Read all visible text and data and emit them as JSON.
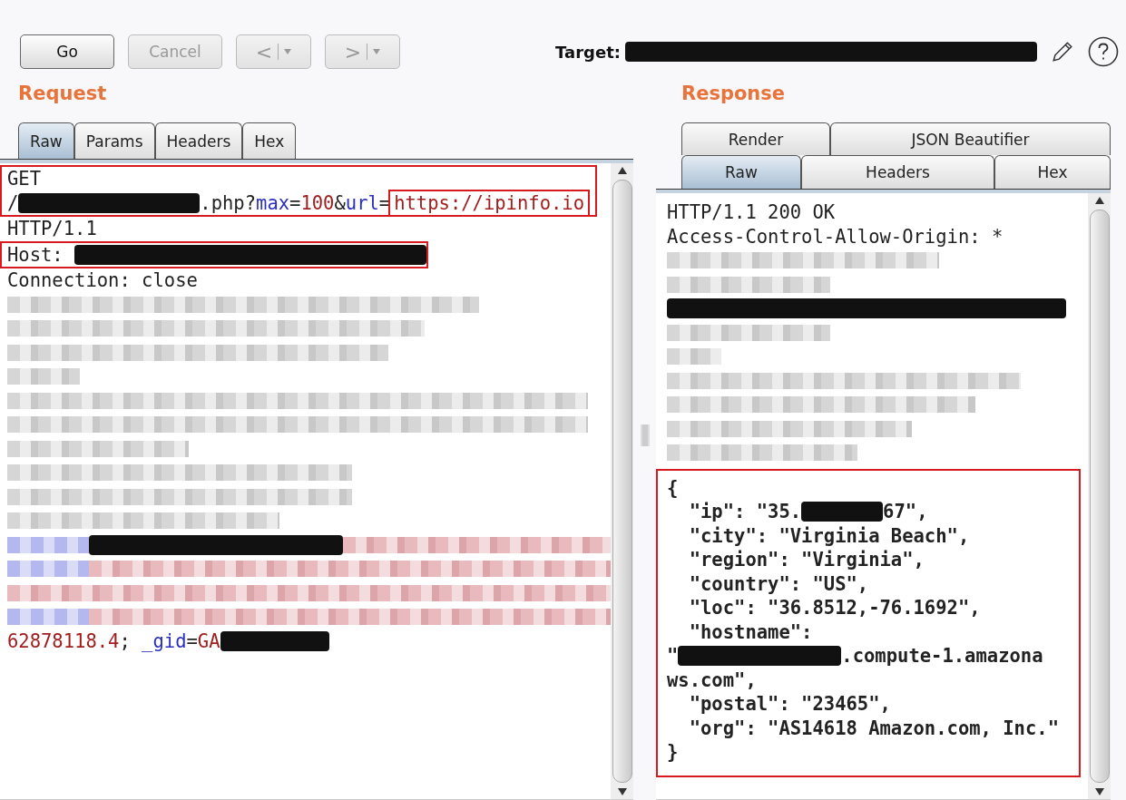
{
  "toolbar": {
    "buttons": [
      {
        "kind": "text",
        "label": "Go",
        "disabled": false
      },
      {
        "kind": "text",
        "label": "Cancel",
        "disabled": true
      },
      {
        "kind": "nav",
        "label": "<",
        "disabled": true
      },
      {
        "kind": "nav",
        "label": ">",
        "disabled": true
      }
    ],
    "target_label": "Target:"
  },
  "request": {
    "title": "Request",
    "tabs": [
      {
        "label": "Raw",
        "selected": true
      },
      {
        "label": "Params",
        "selected": false
      },
      {
        "label": "Headers",
        "selected": false
      },
      {
        "label": "Hex",
        "selected": false
      }
    ],
    "blocks": [
      {
        "annotated": true,
        "lines": [
          [
            {
              "kind": "plain",
              "text": "GET"
            }
          ],
          [
            {
              "kind": "plain",
              "text": "/"
            },
            {
              "kind": "redacted"
            },
            {
              "kind": "plain",
              "text": ".php?"
            },
            {
              "kind": "param",
              "text": "max"
            },
            {
              "kind": "plain",
              "text": "="
            },
            {
              "kind": "value",
              "text": "100"
            },
            {
              "kind": "plain",
              "text": "&"
            },
            {
              "kind": "param",
              "text": "url"
            },
            {
              "kind": "plain",
              "text": "="
            },
            {
              "kind": "value",
              "text": "https://ipinfo.io",
              "annotated": true
            }
          ]
        ]
      },
      {
        "annotated": false,
        "lines": [
          [
            {
              "kind": "plain",
              "text": "HTTP/1.1"
            }
          ]
        ]
      },
      {
        "annotated": true,
        "lines": [
          [
            {
              "kind": "plain",
              "text": "Host: "
            },
            {
              "kind": "redacted"
            }
          ]
        ]
      },
      {
        "annotated": false,
        "lines": [
          [
            {
              "kind": "plain",
              "text": "Connection: close"
            }
          ],
          [
            {
              "kind": "blur"
            }
          ],
          [
            {
              "kind": "blur"
            }
          ],
          [
            {
              "kind": "blur"
            }
          ],
          [
            {
              "kind": "blur"
            }
          ],
          [
            {
              "kind": "blur"
            }
          ],
          [
            {
              "kind": "blur"
            }
          ],
          [
            {
              "kind": "blur"
            }
          ],
          [
            {
              "kind": "blur"
            }
          ],
          [
            {
              "kind": "blur"
            }
          ],
          [
            {
              "kind": "blur"
            }
          ],
          [
            {
              "kind": "blur-blue"
            },
            {
              "kind": "redacted"
            },
            {
              "kind": "blur-red"
            }
          ],
          [
            {
              "kind": "blur-blue"
            },
            {
              "kind": "blur-red"
            }
          ],
          [
            {
              "kind": "blur-red"
            }
          ],
          [
            {
              "kind": "blur-blue"
            },
            {
              "kind": "blur-red"
            }
          ],
          [
            {
              "kind": "value",
              "text": "62878118.4"
            },
            {
              "kind": "plain",
              "text": "; "
            },
            {
              "kind": "param",
              "text": "_gid"
            },
            {
              "kind": "plain",
              "text": "="
            },
            {
              "kind": "value",
              "text": "GA"
            },
            {
              "kind": "redacted"
            }
          ]
        ]
      }
    ]
  },
  "response": {
    "title": "Response",
    "tab_rows": [
      [
        {
          "label": "Render",
          "selected": false
        },
        {
          "label": "JSON Beautifier",
          "selected": false
        }
      ],
      [
        {
          "label": "Raw",
          "selected": true
        },
        {
          "label": "Headers",
          "selected": false
        },
        {
          "label": "Hex",
          "selected": false
        }
      ]
    ],
    "blocks": [
      {
        "annotated": false,
        "lines": [
          [
            {
              "kind": "plain",
              "text": "HTTP/1.1 200 OK"
            }
          ],
          [
            {
              "kind": "plain",
              "text": "Access-Control-Allow-Origin: *"
            }
          ],
          [
            {
              "kind": "blur"
            }
          ],
          [
            {
              "kind": "blur"
            }
          ],
          [
            {
              "kind": "redacted"
            }
          ],
          [
            {
              "kind": "blur"
            }
          ],
          [
            {
              "kind": "blur"
            }
          ],
          [
            {
              "kind": "blur"
            }
          ],
          [
            {
              "kind": "blur"
            }
          ],
          [
            {
              "kind": "blur"
            }
          ],
          [
            {
              "kind": "blur"
            }
          ]
        ]
      },
      {
        "annotated": true,
        "lines": [
          [
            {
              "kind": "plain",
              "text": "{"
            }
          ],
          [
            {
              "kind": "plain",
              "text": "  \"ip\": \"35."
            },
            {
              "kind": "redacted"
            },
            {
              "kind": "plain",
              "text": "67\","
            }
          ],
          [
            {
              "kind": "plain",
              "text": "  \"city\": \"Virginia Beach\","
            }
          ],
          [
            {
              "kind": "plain",
              "text": "  \"region\": \"Virginia\","
            }
          ],
          [
            {
              "kind": "plain",
              "text": "  \"country\": \"US\","
            }
          ],
          [
            {
              "kind": "plain",
              "text": "  \"loc\": \"36.8512,-76.1692\","
            }
          ],
          [
            {
              "kind": "plain",
              "text": "  \"hostname\":"
            }
          ],
          [
            {
              "kind": "plain",
              "text": "\""
            },
            {
              "kind": "redacted"
            },
            {
              "kind": "plain",
              "text": ".compute-1.amazona"
            }
          ],
          [
            {
              "kind": "plain",
              "text": "ws.com\","
            }
          ],
          [
            {
              "kind": "plain",
              "text": "  \"postal\": \"23465\","
            }
          ],
          [
            {
              "kind": "plain",
              "text": "  \"org\": \"AS14618 Amazon.com, Inc.\""
            }
          ],
          [
            {
              "kind": "plain",
              "text": "}"
            }
          ]
        ]
      }
    ]
  }
}
